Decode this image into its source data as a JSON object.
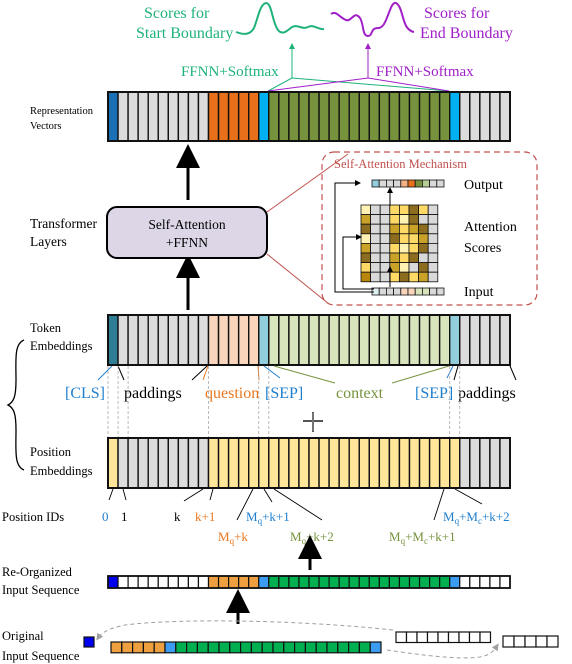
{
  "top": {
    "start_scores_label": [
      "Scores for",
      "Start Boundary"
    ],
    "end_scores_label": [
      "Scores for",
      "End Boundary"
    ],
    "ffnn_start": "FFNN+Softmax",
    "ffnn_end": "FFNN+Softmax"
  },
  "colors": {
    "start_green": "#1fb37a",
    "end_purple": "#a020c8",
    "cls_blue": "#1a6fb5",
    "question_orange": "#e8701a",
    "sep_cyan": "#00b0f0",
    "context_green": "#76923c",
    "padding_gray": "#dcdcdc",
    "token_cls": "#2e7e96",
    "token_question": "#f8d5bb",
    "token_sep": "#92cddc",
    "token_context": "#d8e4bc",
    "position_yellow": "#ffe699",
    "reorg_blue": "#0000ee",
    "reorg_orange": "#eea040",
    "reorg_sep": "#3b9cf2",
    "reorg_green": "#00b050",
    "mechanism_red": "#c0504d",
    "transformer_fill": "#dcd6e6",
    "label_blue": "#1f7fcf",
    "label_orange": "#e8771e",
    "label_green": "#76923c"
  },
  "rows": {
    "representation": [
      "Representation",
      "Vectors"
    ],
    "transformer": [
      "Transformer",
      "Layers"
    ],
    "token": [
      "Token",
      "Embeddings"
    ],
    "position": [
      "Position",
      "Embeddings"
    ],
    "position_ids": "Position IDs",
    "reorganized": [
      "Re-Organized",
      "Input Sequence"
    ],
    "original": [
      "Original",
      "Input Sequence"
    ]
  },
  "sequence_layout": {
    "cls": 1,
    "paddings_front": 9,
    "question": 5,
    "sep1": 1,
    "context": 18,
    "sep2": 1,
    "paddings_back": 5
  },
  "transformer_box": [
    "Self-Attention",
    "+FFNN"
  ],
  "mechanism": {
    "title": "Self-Attention Mechanism",
    "output_label": "Output",
    "scores_label": [
      "Attention",
      "Scores"
    ],
    "input_label": "Input"
  },
  "token_labels": {
    "cls": "[CLS]",
    "paddings1": "paddings",
    "question": "question",
    "sep1": "[SEP]",
    "context": "context",
    "sep2": "[SEP]",
    "paddings2": "paddings"
  },
  "plus": "+",
  "position_ids": {
    "id0": "0",
    "id1": "1",
    "idk": "k",
    "idk1": "k+1",
    "mqk": "M_q+k",
    "mqk1": "M_q+k+1",
    "mqk2": "M_q+k+2",
    "mqmck1": "M_q+M_c+k+1",
    "mqmck2": "M_q+M_c+k+2"
  }
}
